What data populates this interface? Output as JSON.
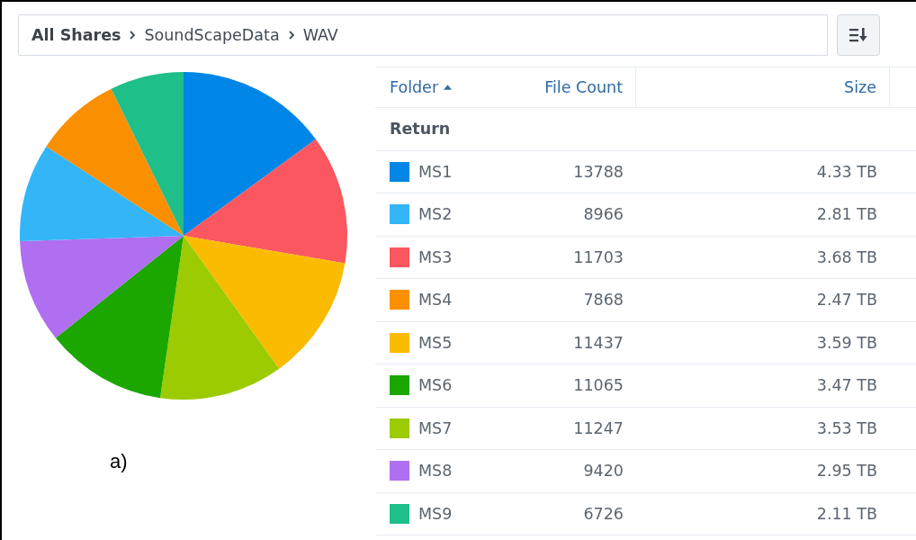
{
  "breadcrumb": [
    {
      "label": "All Shares",
      "kind": "root"
    },
    {
      "label": "SoundScapeData",
      "kind": "folder"
    },
    {
      "label": "WAV",
      "kind": "folder"
    }
  ],
  "caption": "a)",
  "table": {
    "columns": [
      {
        "label": "Folder",
        "sorted": true
      },
      {
        "label": "File Count",
        "sorted": false
      },
      {
        "label": "Size",
        "sorted": false
      }
    ],
    "group": "Return",
    "rows": [
      {
        "folder": "MS1",
        "file_count": "13788",
        "size": "4.33 TB",
        "color": "#0086e6"
      },
      {
        "folder": "MS2",
        "file_count": "8966",
        "size": "2.81 TB",
        "color": "#33b5f8"
      },
      {
        "folder": "MS3",
        "file_count": "11703",
        "size": "3.68 TB",
        "color": "#fa5760"
      },
      {
        "folder": "MS4",
        "file_count": "7868",
        "size": "2.47 TB",
        "color": "#fa8f00"
      },
      {
        "folder": "MS5",
        "file_count": "11437",
        "size": "3.59 TB",
        "color": "#fbbb00"
      },
      {
        "folder": "MS6",
        "file_count": "11065",
        "size": "3.47 TB",
        "color": "#1ba600"
      },
      {
        "folder": "MS7",
        "file_count": "11247",
        "size": "3.53 TB",
        "color": "#9bcb00"
      },
      {
        "folder": "MS8",
        "file_count": "9420",
        "size": "2.95 TB",
        "color": "#b06ef0"
      },
      {
        "folder": "MS9",
        "file_count": "6726",
        "size": "2.11 TB",
        "color": "#1ebf88"
      }
    ]
  }
}
